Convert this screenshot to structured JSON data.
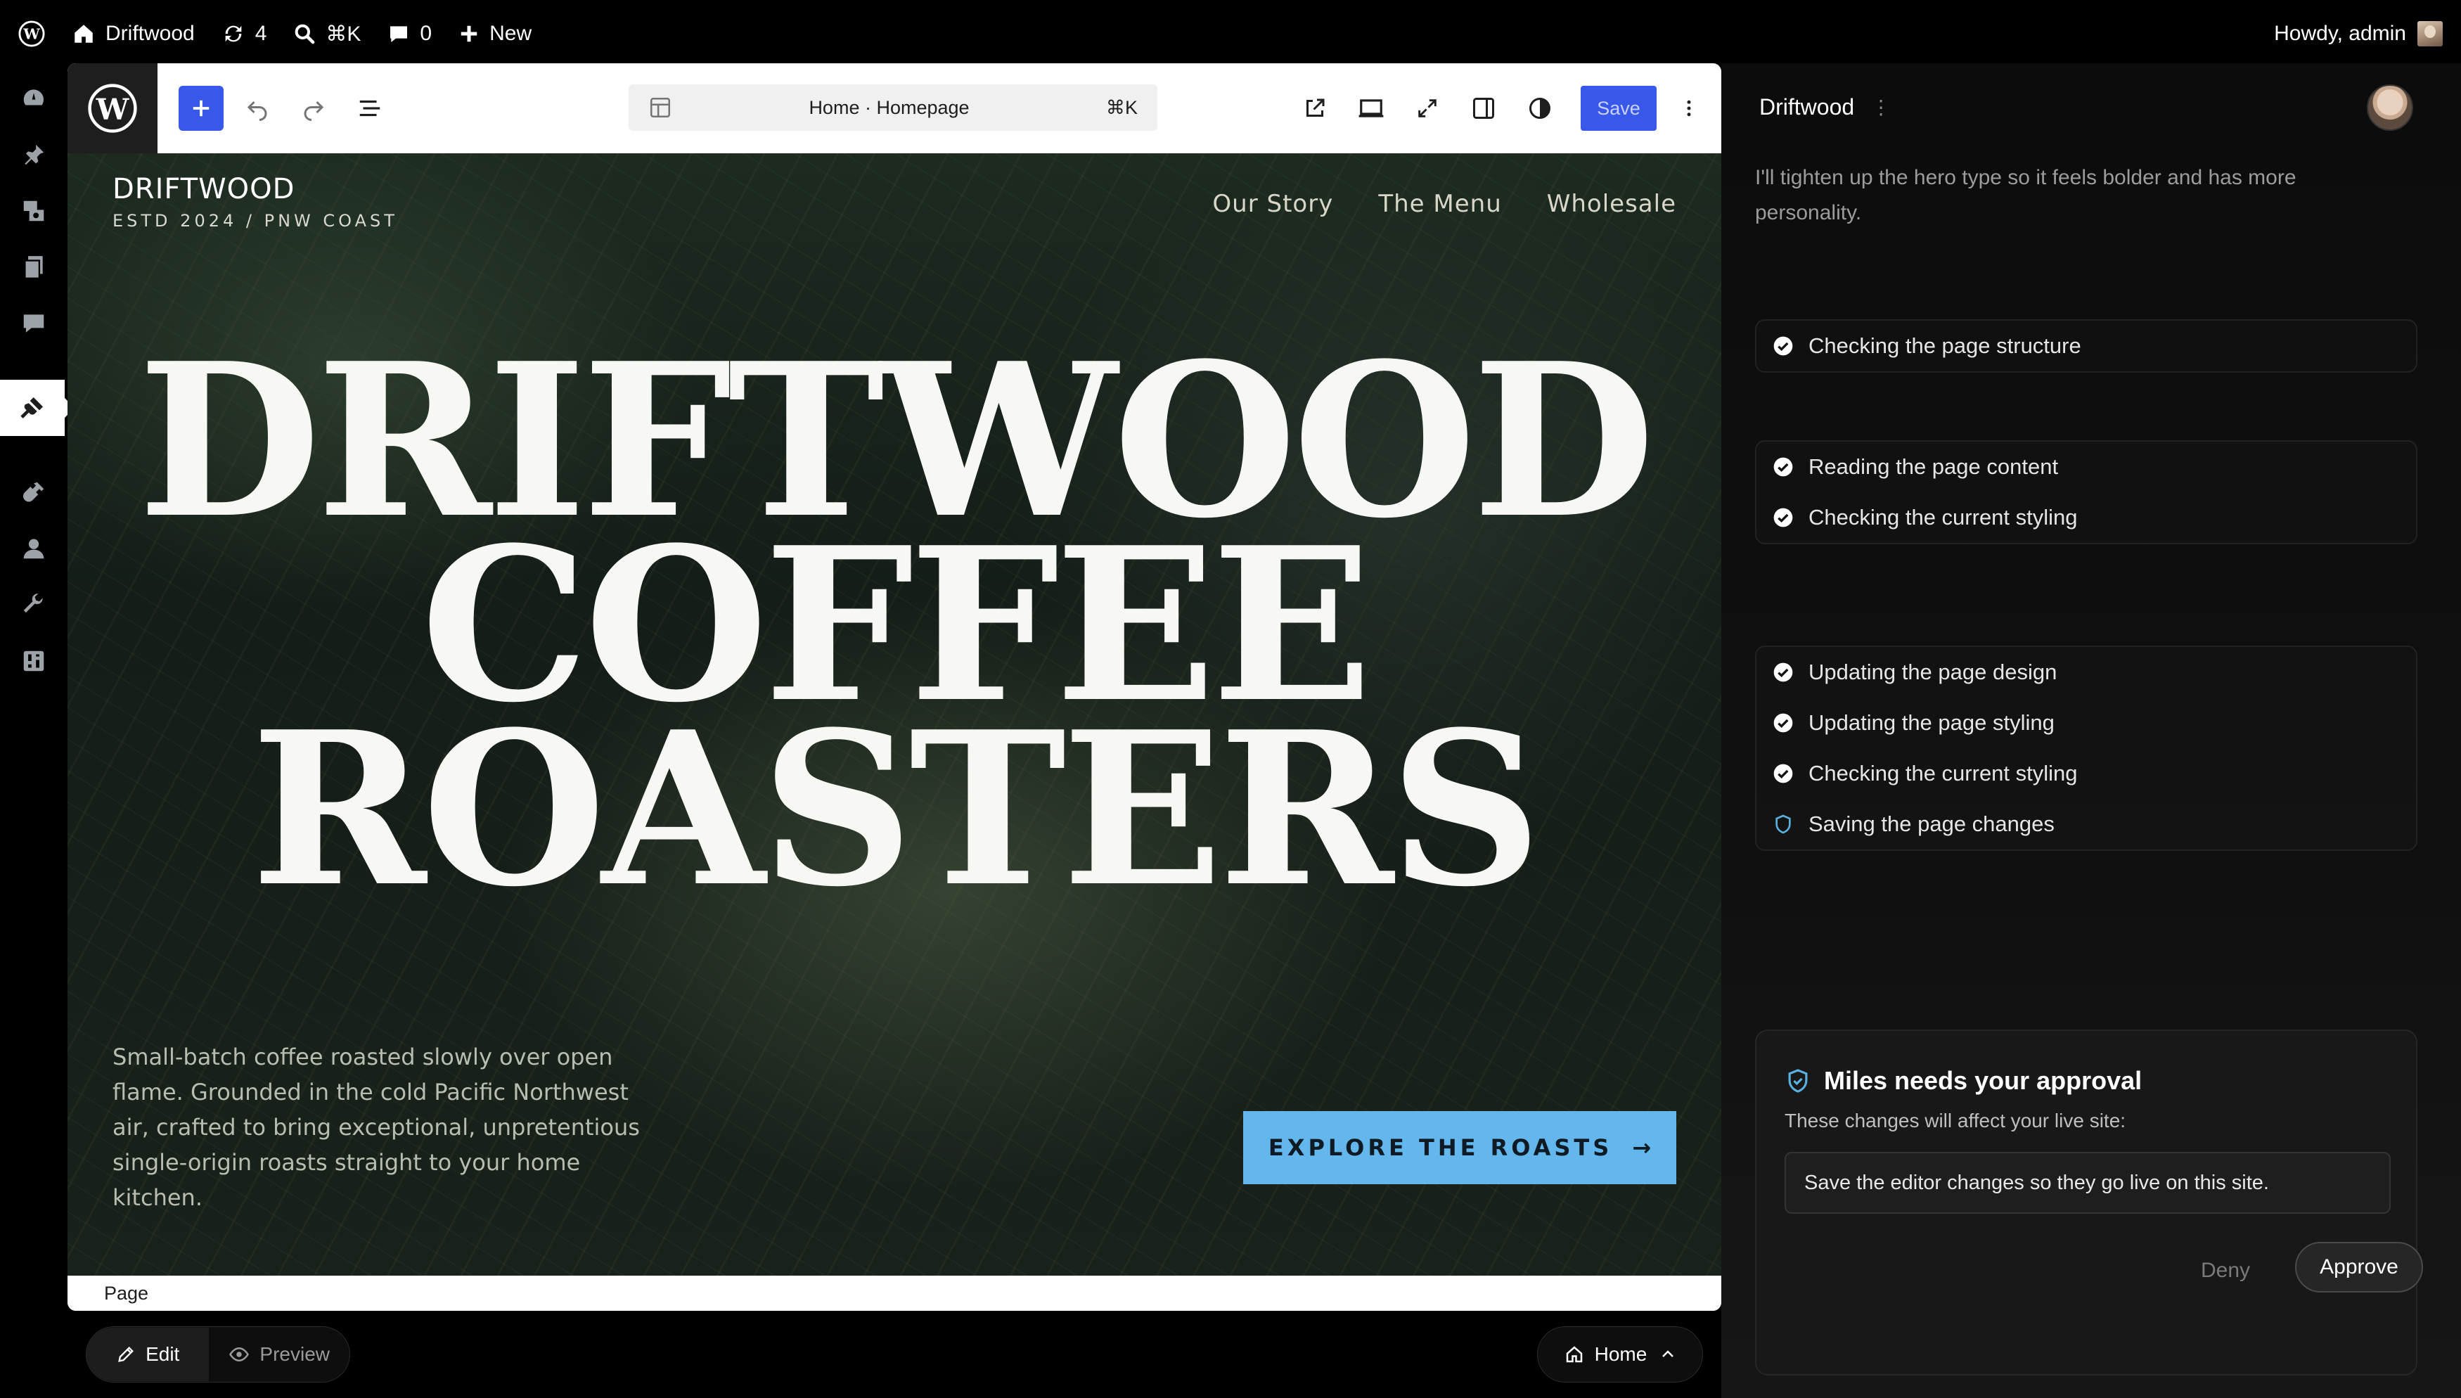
{
  "admin_bar": {
    "site_name": "Driftwood",
    "updates_count": "4",
    "search_shortcut": "⌘K",
    "comments_count": "0",
    "new_label": "New",
    "greeting": "Howdy, admin"
  },
  "sidebar": {
    "items": [
      {
        "icon": "dashboard-icon"
      },
      {
        "icon": "pin-icon"
      },
      {
        "icon": "media-icon"
      },
      {
        "icon": "pages-icon"
      },
      {
        "icon": "comments-icon"
      },
      {
        "icon": "appearance-icon",
        "active": true
      },
      {
        "icon": "plugins-icon"
      },
      {
        "icon": "users-icon"
      },
      {
        "icon": "tools-icon"
      },
      {
        "icon": "settings-icon"
      }
    ]
  },
  "toolbar": {
    "document_title": "Home · Homepage",
    "document_shortcut": "⌘K",
    "save_label": "Save"
  },
  "site": {
    "brand_name": "DRIFTWOOD",
    "brand_tagline": "ESTD 2024 / PNW COAST",
    "nav": [
      "Our Story",
      "The Menu",
      "Wholesale"
    ],
    "hero_lines": [
      "DRIFTWOOD",
      "COFFEE",
      "ROASTERS"
    ],
    "intro": "Small-batch coffee roasted slowly over open flame. Grounded in the cold Pacific Northwest air, crafted to bring exceptional, unpretentious single-origin roasts straight to your home kitchen.",
    "cta_label": "EXPLORE THE ROASTS",
    "cta_arrow": "→"
  },
  "footer": {
    "breadcrumb": "Page"
  },
  "bottom": {
    "edit_label": "Edit",
    "preview_label": "Preview",
    "page_switch_label": "Home"
  },
  "panel": {
    "agent_name": "Driftwood",
    "message": "I'll tighten up the hero type so it feels bolder and has more personality.",
    "groups": [
      {
        "tasks": [
          {
            "label": "Checking the page structure",
            "status": "done"
          }
        ]
      },
      {
        "tasks": [
          {
            "label": "Reading the page content",
            "status": "done"
          },
          {
            "label": "Checking the current styling",
            "status": "done"
          }
        ]
      },
      {
        "tasks": [
          {
            "label": "Updating the page design",
            "status": "done"
          },
          {
            "label": "Updating the page styling",
            "status": "done"
          },
          {
            "label": "Checking the current styling",
            "status": "done"
          },
          {
            "label": "Saving the page changes",
            "status": "pending"
          }
        ]
      }
    ],
    "approval": {
      "title": "Miles needs your approval",
      "subtitle": "These changes will affect your live site:",
      "detail": "Save the editor changes so they go live on this site.",
      "deny_label": "Deny",
      "approve_label": "Approve"
    }
  },
  "colors": {
    "accent": "#3858e9",
    "cta": "#64b7ec",
    "pending_icon": "#5ab0e0"
  }
}
